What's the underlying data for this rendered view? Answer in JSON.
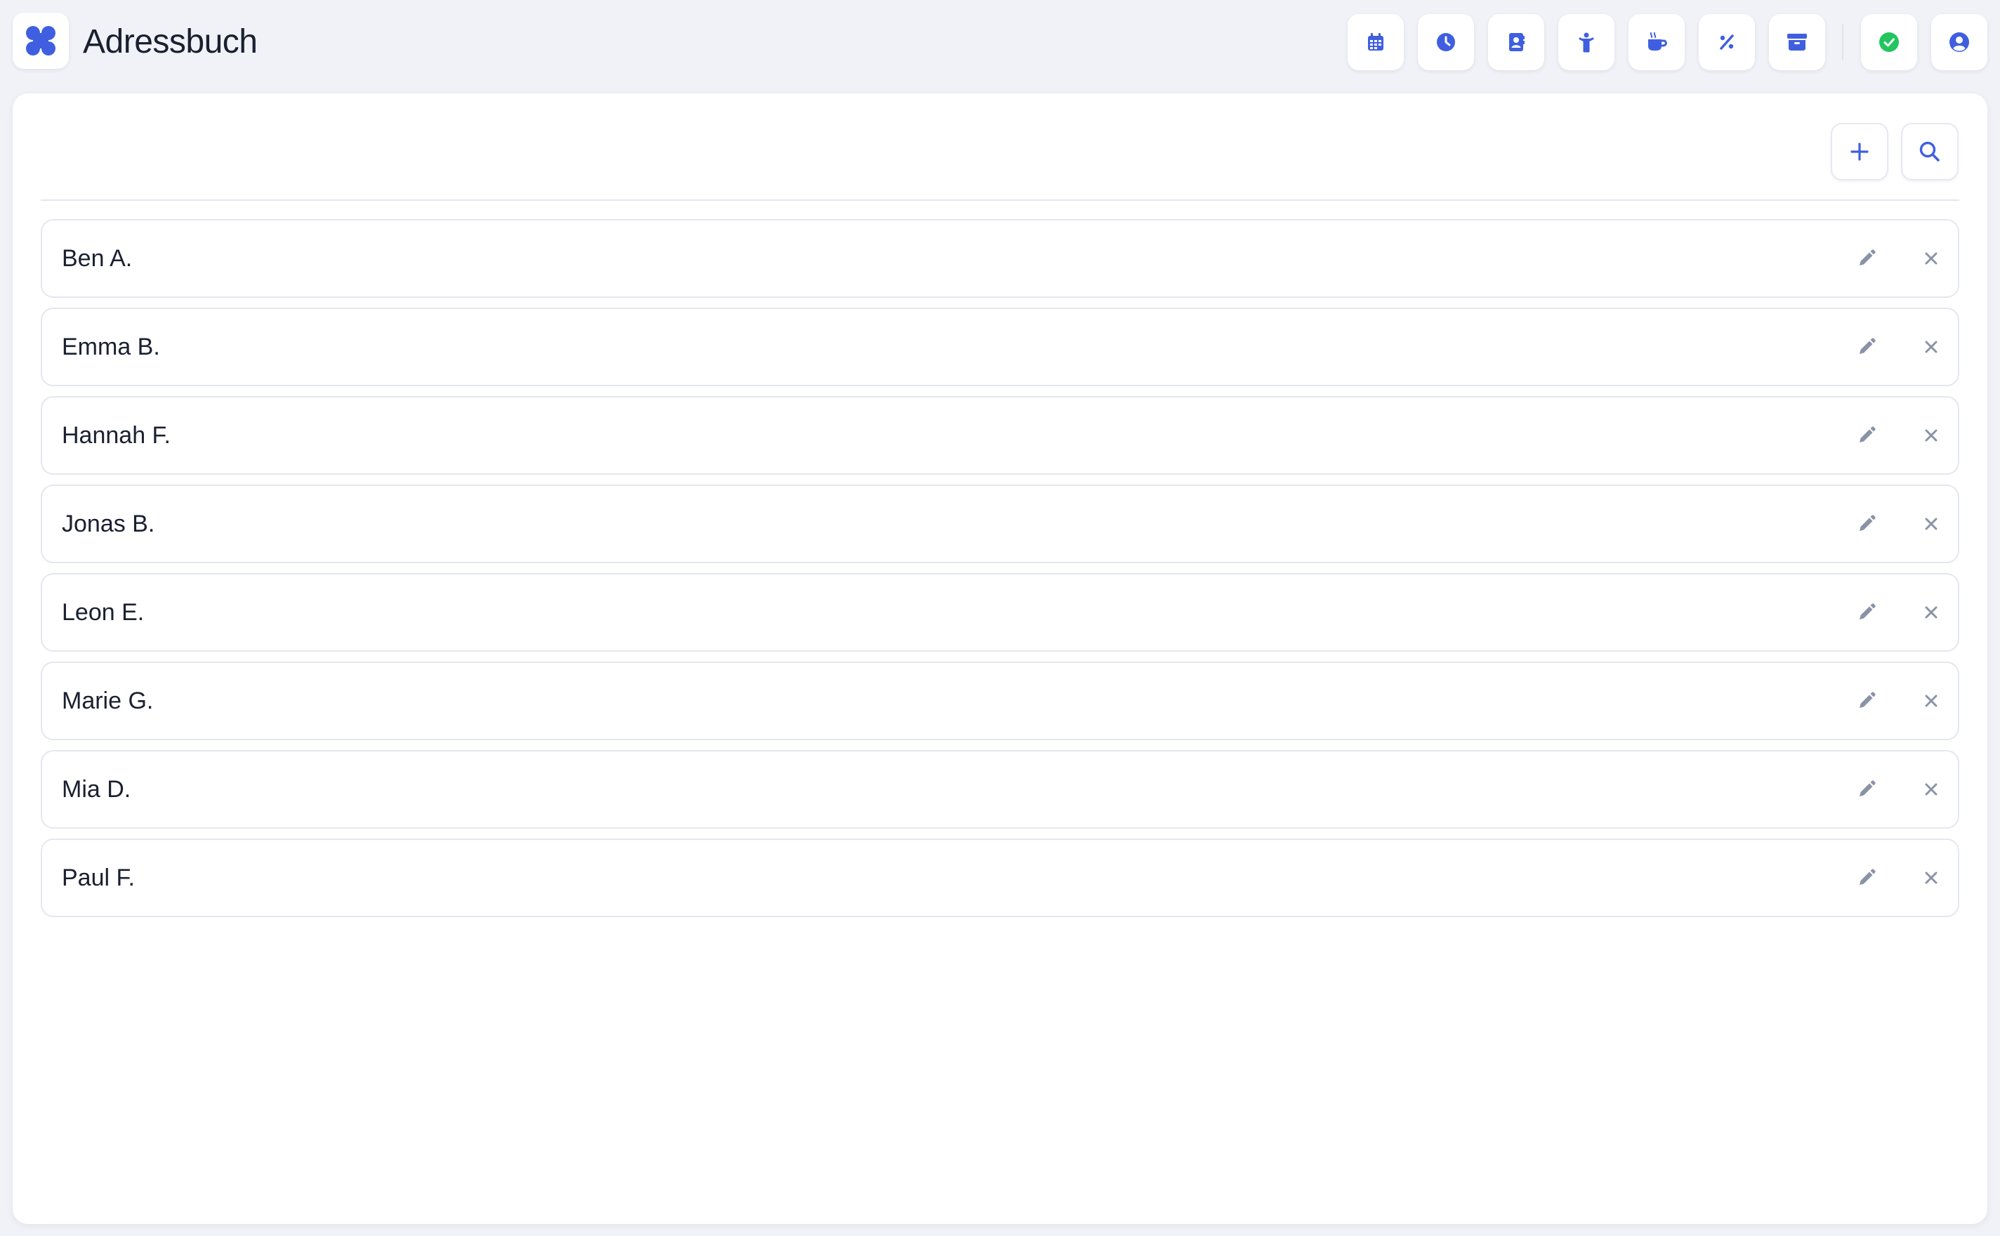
{
  "app": {
    "title": "Adressbuch",
    "logo_icon": "app-logo-icon"
  },
  "colors": {
    "accent": "#3f5fe0",
    "success": "#22c55e",
    "muted_icon": "#8a93a6",
    "background": "#f0f2f7",
    "card": "#ffffff"
  },
  "nav": {
    "items": [
      {
        "icon": "calendar-icon"
      },
      {
        "icon": "clock-icon"
      },
      {
        "icon": "address-book-icon"
      },
      {
        "icon": "person-icon"
      },
      {
        "icon": "coffee-icon"
      },
      {
        "icon": "percent-icon"
      },
      {
        "icon": "archive-icon"
      }
    ],
    "status_icon": "check-circle-icon",
    "account_icon": "user-circle-icon"
  },
  "toolbar": {
    "add_icon": "plus-icon",
    "search_icon": "search-icon"
  },
  "contacts": [
    {
      "name": "Ben A."
    },
    {
      "name": "Emma B."
    },
    {
      "name": "Hannah F."
    },
    {
      "name": "Jonas B."
    },
    {
      "name": "Leon E."
    },
    {
      "name": "Marie G."
    },
    {
      "name": "Mia D."
    },
    {
      "name": "Paul F."
    }
  ],
  "row_actions": {
    "edit_icon": "pencil-icon",
    "delete_icon": "close-icon"
  }
}
